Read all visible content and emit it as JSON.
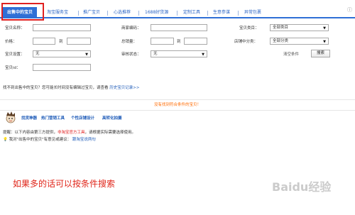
{
  "tabs": [
    {
      "label": "出售中的宝贝",
      "active": true
    },
    {
      "label": "淘宝服务宝"
    },
    {
      "label": "推广宝贝"
    },
    {
      "label": "心选推荐"
    },
    {
      "label": "1688好货源"
    },
    {
      "label": "定制工具"
    },
    {
      "label": "生意参谋"
    },
    {
      "label": "异常包裹"
    }
  ],
  "help_icon": "help-icon",
  "filters": {
    "title_label": "宝贝名称：",
    "code_label": "商家编码：",
    "category_label": "宝贝类目：",
    "category_value": "全部类目",
    "price_label": "价格：",
    "range_to": "到",
    "sales_label": "总销量：",
    "shop_category_label": "店铺中分类：",
    "shop_category_value": "全部分类",
    "settings_label": "宝贝设置：",
    "settings_value": "无",
    "audit_label": "审核状态：",
    "audit_value": "无",
    "id_label": "宝贝id：",
    "clear_label": "清空条件",
    "search_label": "搜索"
  },
  "hint": {
    "text": "找不到出售中的宝贝？您可能长时间没有编辑过宝贝，请查看",
    "link": "历史宝贝记录>>"
  },
  "empty_message": "没有找到符合条件的宝贝！",
  "tools": {
    "items": [
      "找货神器",
      "热门营销工具",
      "个性店铺设计",
      "高转化拍摄"
    ],
    "notice_prefix": "提醒：以下内容由第三方提供，",
    "notice_red": "非淘宝官方工具",
    "notice_suffix": "，请根据实际需要选择使用。",
    "feedback_prefix": "我对\"出售中的宝贝\"有意见或建议：",
    "feedback_link": "跟淘宝说两句"
  },
  "caption": "如果多的话可以按条件搜索",
  "watermark": "Baidu经验",
  "colors": {
    "tab_blue": "#2f6fd6",
    "highlight_red": "#e02020",
    "notice_orange": "#ff6a00",
    "link_blue": "#1e5bb8"
  }
}
